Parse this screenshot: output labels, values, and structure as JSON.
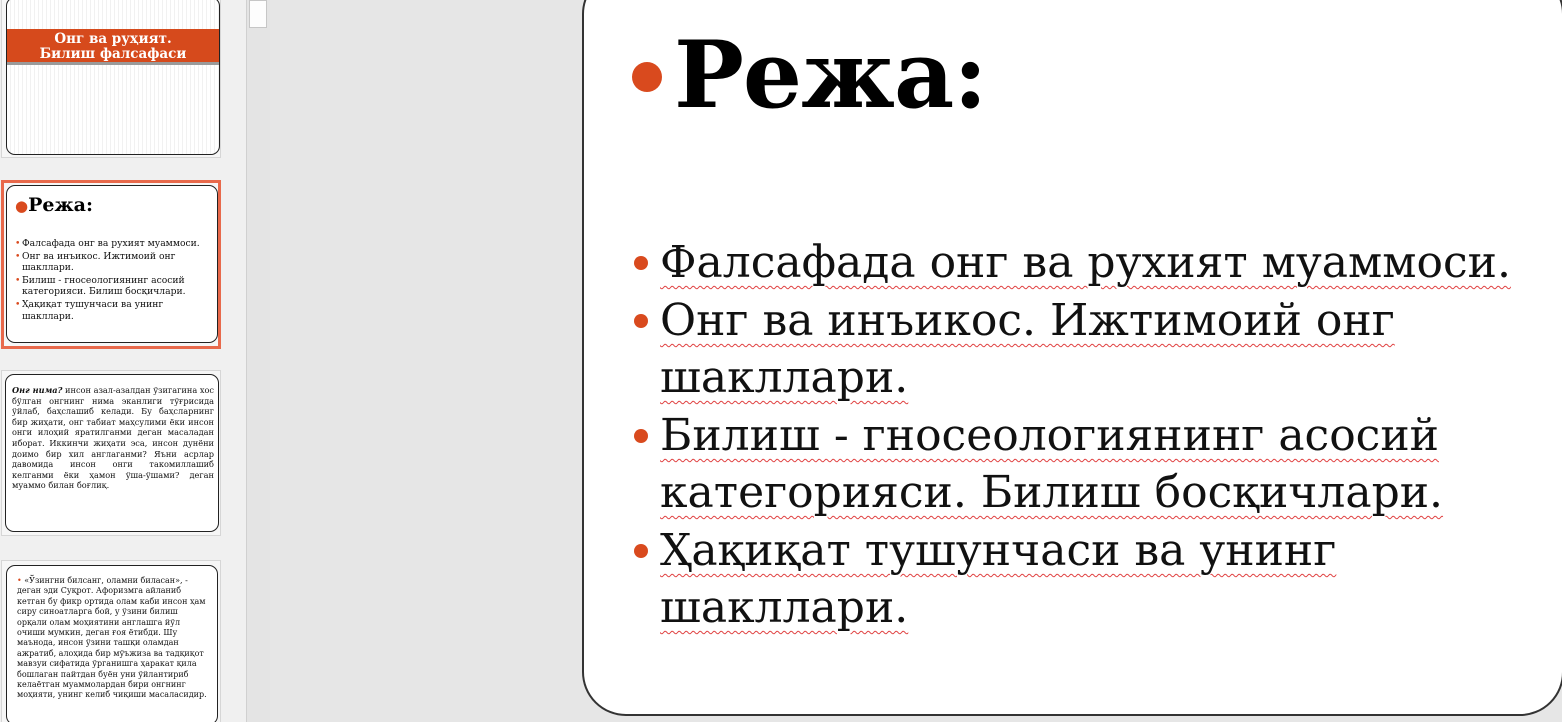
{
  "colors": {
    "accent": "#d94a1e",
    "selection": "#e8694b",
    "canvas": "#e6e6e6"
  },
  "thumbnails": [
    {
      "banner_line1": "Онг ва руҳият.",
      "banner_line2": "Билиш фалсафаси"
    },
    {
      "title": "Режа:",
      "items": [
        "Фалсафада онг ва рухият муаммоси.",
        "Онг ва инъикос. Ижтимоий онг шакллари.",
        "Билиш - гносеологиянинг асосий категорияси. Билиш босқичлари.",
        "Ҳақиқат тушунчаси ва унинг шакллари."
      ]
    },
    {
      "lead": "Онг нима?",
      "text": "инсон азал-азалдан ўзигагина хос бўлган онгнинг нима эканлиги тўғрисида ўйлаб, баҳслашиб келади. Бу баҳсларнинг бир жиҳати, онг табиат маҳсулими ёки инсон онги илоҳий яратилганми деган масаладан иборат. Иккинчи жиҳати эса, инсон дунёни доимо бир хил англаганми? Яъни асрлар давомида инсон онги такомиллашиб келганми ёки ҳамон ўша-ўшами? деган муаммо билан боғлиқ."
    },
    {
      "text": "«Ўзингни билсанг, оламни биласан», - деган эди Суқрот. Афоризмга айланиб кетган бу фикр ортида олам каби инсон ҳам сиру синоатларга бой, у ўзини билиш орқали олам моҳиятини англашга йўл очиши мумкин, деган ғоя ётибди. Шу маънода, инсон ўзини ташқи оламдан ажратиб, алоҳида бир мўъжиза ва тадқиқот мавзуи сифатида ўрганишга ҳаракат қила бошлаган пайтдан буён уни ўйлантириб келаётган муаммолардан бири онгнинг моҳияти, унинг келиб чиқиши масаласидир."
    }
  ],
  "main_slide": {
    "title": "Режа:",
    "items": [
      "Фалсафада онг ва рухият муаммоси.",
      "Онг ва инъикос. Ижтимоий онг шакллари.",
      "Билиш - гносеологиянинг асосий категорияси. Билиш босқичлари.",
      "Ҳақиқат тушунчаси ва унинг шакллари."
    ]
  }
}
